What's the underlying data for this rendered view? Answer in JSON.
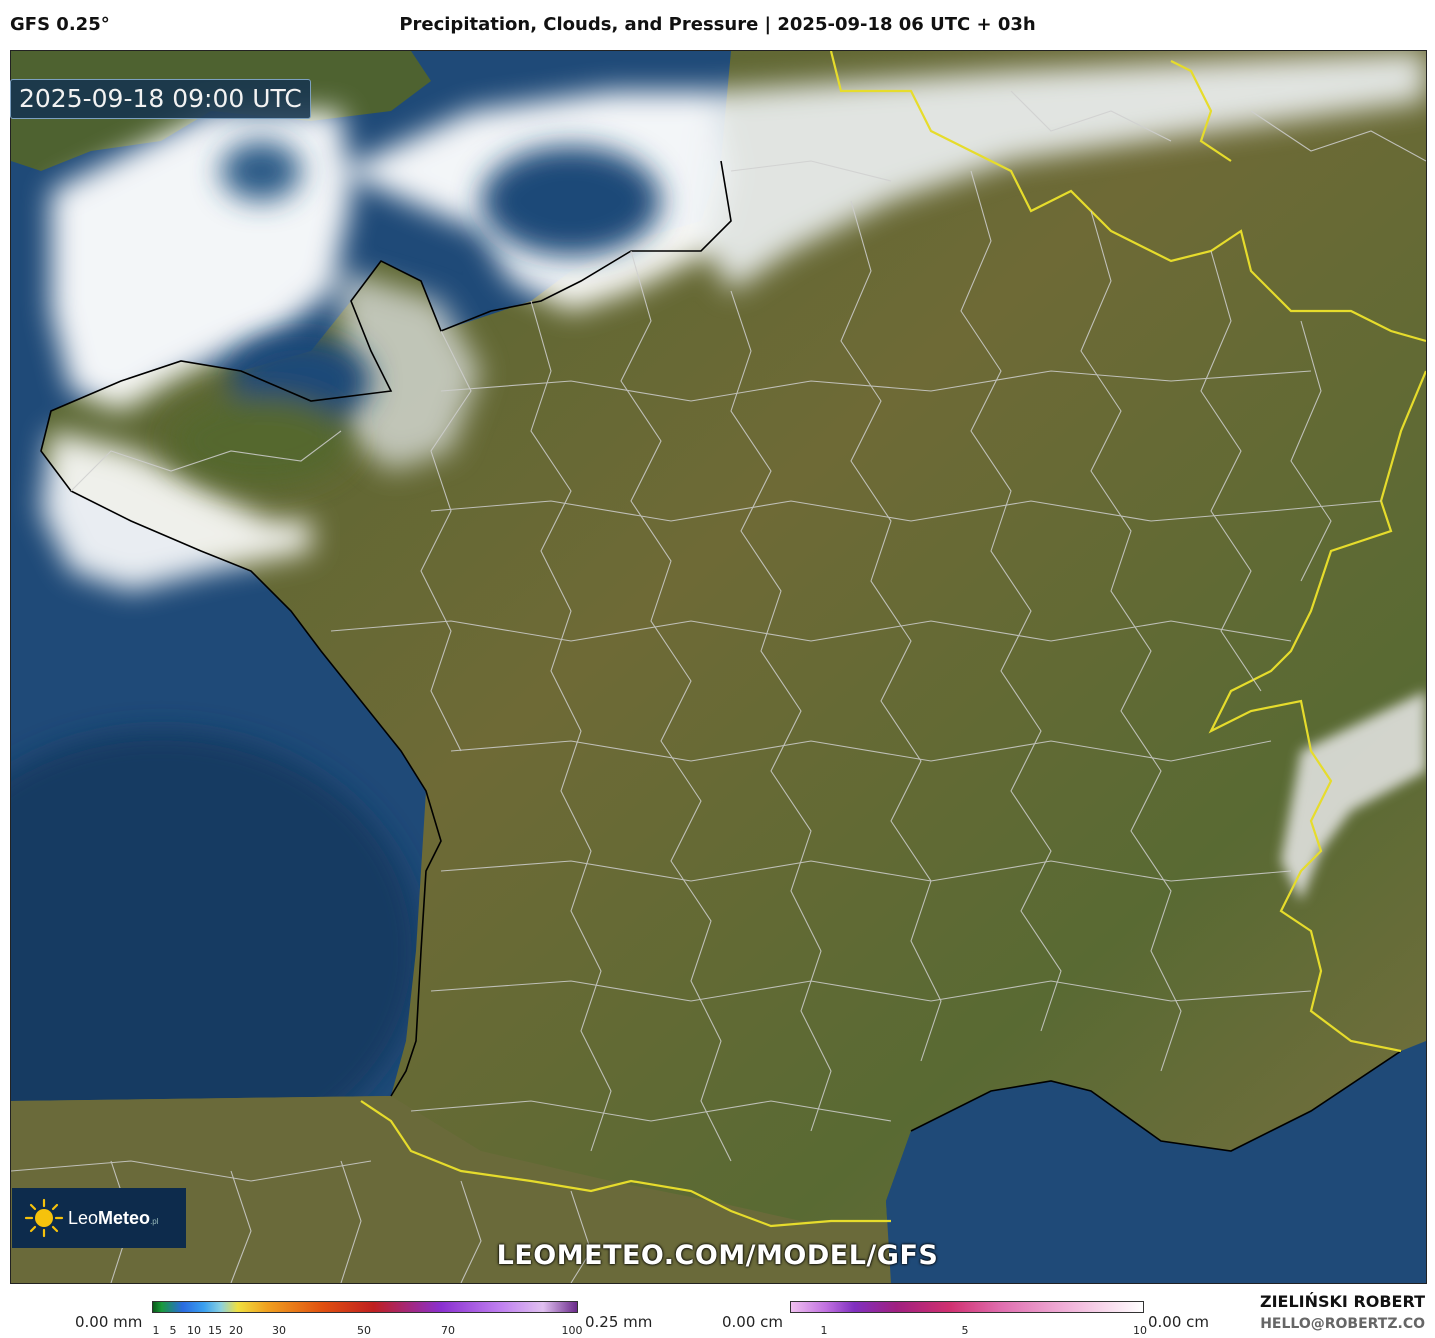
{
  "header": {
    "model": "GFS 0.25°",
    "title": "Precipitation, Clouds, and Pressure | 2025-09-18 06 UTC + 03h"
  },
  "map": {
    "timestamp": "2025-09-18 09:00 UTC",
    "watermark": "LEOMETEO.COM/MODEL/GFS",
    "logo_text_light": "Leo",
    "logo_text_bold": "Meteo",
    "logo_suffix": ".pl"
  },
  "legend_precip": {
    "min_label": "0.00 mm",
    "max_label": "0.25 mm",
    "ticks": [
      "1",
      "5",
      "10",
      "15",
      "20",
      "30",
      "50",
      "70",
      "100"
    ]
  },
  "legend_snow": {
    "min_label": "0.00 cm",
    "max_label": "0.00 cm",
    "ticks": [
      "1",
      "5",
      "10"
    ]
  },
  "footer": {
    "author": "ZIELIŃSKI ROBERT",
    "email": "HELLO@ROBERTZ.CO"
  },
  "colors": {
    "sea": "#1f4a78",
    "land": "#5a6b34",
    "cloud": "#ffffff",
    "border_country": "#e8e030",
    "border_region": "#c8c8c8",
    "coast": "#000000"
  }
}
